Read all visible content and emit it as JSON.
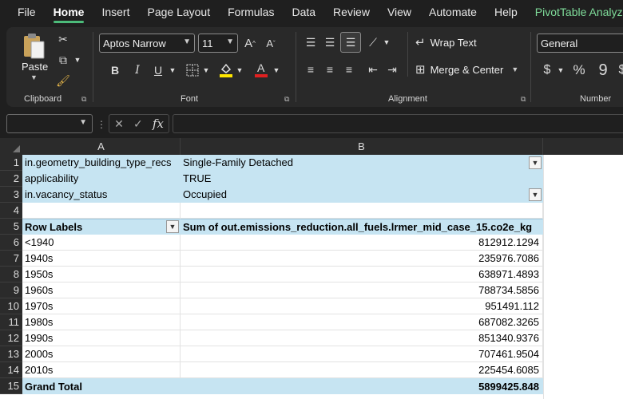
{
  "menu": {
    "tabs": [
      "File",
      "Home",
      "Insert",
      "Page Layout",
      "Formulas",
      "Data",
      "Review",
      "View",
      "Automate",
      "Help",
      "PivotTable Analyze"
    ],
    "active": "Home"
  },
  "ribbon": {
    "clipboard": {
      "label": "Clipboard",
      "paste": "Paste"
    },
    "font": {
      "label": "Font",
      "family": "Aptos Narrow",
      "size": "11"
    },
    "alignment": {
      "label": "Alignment",
      "wrap_text": "Wrap Text",
      "merge_center": "Merge & Center"
    },
    "number": {
      "label": "Number",
      "format": "General"
    }
  },
  "formula_bar": {
    "namebox": "",
    "fx": "fx",
    "value": ""
  },
  "columns": [
    "A",
    "B"
  ],
  "rows": [
    "1",
    "2",
    "3",
    "4",
    "5",
    "6",
    "7",
    "8",
    "9",
    "10",
    "11",
    "12",
    "13",
    "14",
    "15"
  ],
  "filters": [
    {
      "field": "in.geometry_building_type_recs",
      "value": "Single-Family Detached"
    },
    {
      "field": "applicability",
      "value": "TRUE"
    },
    {
      "field": "in.vacancy_status",
      "value": "Occupied"
    }
  ],
  "pivot": {
    "row_labels": "Row Labels",
    "value_header": "Sum of out.emissions_reduction.all_fuels.lrmer_mid_case_15.co2e_kg",
    "items": [
      {
        "label": "<1940",
        "value": "812912.1294"
      },
      {
        "label": "1940s",
        "value": "235976.7086"
      },
      {
        "label": "1950s",
        "value": "638971.4893"
      },
      {
        "label": "1960s",
        "value": "788734.5856"
      },
      {
        "label": "1970s",
        "value": "951491.112"
      },
      {
        "label": "1980s",
        "value": "687082.3265"
      },
      {
        "label": "1990s",
        "value": "851340.9376"
      },
      {
        "label": "2000s",
        "value": "707461.9504"
      },
      {
        "label": "2010s",
        "value": "225454.6085"
      }
    ],
    "grand_total_label": "Grand Total",
    "grand_total_value": "5899425.848"
  },
  "colors": {
    "accent": "#4cbb7a",
    "pivot_fill": "#c6e4f2"
  }
}
